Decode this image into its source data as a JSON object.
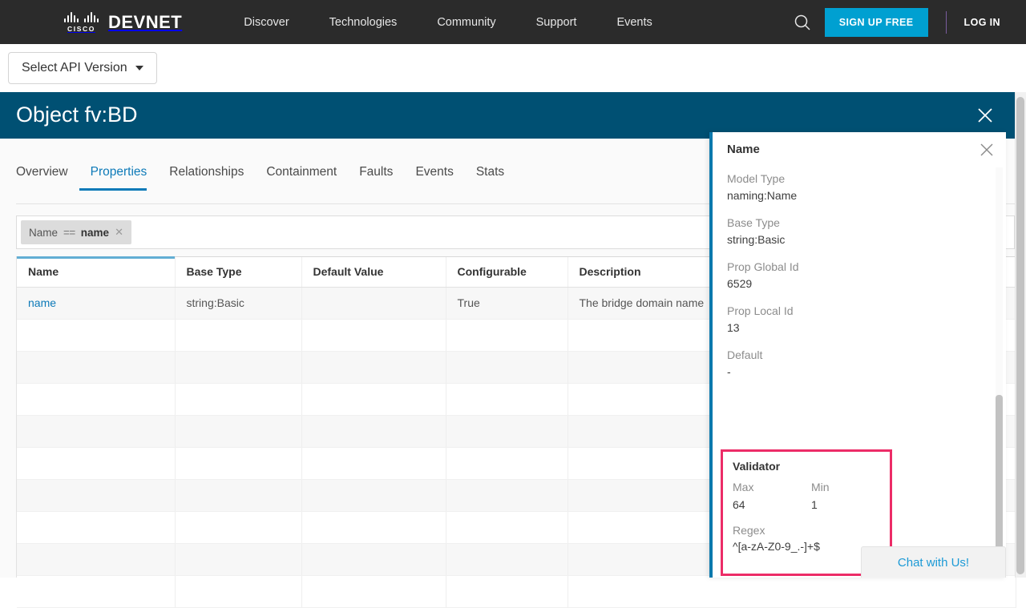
{
  "topnav": {
    "brand_cisco": "CISCO",
    "brand_devnet": "DEVNET",
    "links": [
      "Discover",
      "Technologies",
      "Community",
      "Support",
      "Events"
    ],
    "search_icon": "search-icon",
    "signup_label": "SIGN UP FREE",
    "login_label": "LOG IN",
    "bg_color": "#2b2b2b",
    "accent_color": "#00a0d1"
  },
  "apibar": {
    "select_api_version_label": "Select API Version"
  },
  "object_header": {
    "title": "Object fv:BD",
    "close_icon": "close-icon",
    "bg_color": "#005073"
  },
  "tabs": [
    {
      "label": "Overview",
      "active": false
    },
    {
      "label": "Properties",
      "active": true
    },
    {
      "label": "Relationships",
      "active": false
    },
    {
      "label": "Containment",
      "active": false
    },
    {
      "label": "Faults",
      "active": false
    },
    {
      "label": "Events",
      "active": false
    },
    {
      "label": "Stats",
      "active": false
    }
  ],
  "filter": {
    "chip_field": "Name",
    "chip_operator": "==",
    "chip_value": "name",
    "chip_remove_icon": "close-icon"
  },
  "table": {
    "columns": [
      "Name",
      "Base Type",
      "Default Value",
      "Configurable",
      "Description"
    ],
    "rows": [
      {
        "name": "name",
        "base_type": "string:Basic",
        "default_value": "",
        "configurable": "True",
        "description": "The bridge domain name"
      }
    ],
    "empty_row_count": 9,
    "accent_color": "#62aed4"
  },
  "panel": {
    "title": "Name",
    "close_icon": "close-icon",
    "accent_color": "#0b79ad",
    "fields": [
      {
        "label": "Model Type",
        "value": "naming:Name"
      },
      {
        "label": "Base Type",
        "value": "string:Basic"
      },
      {
        "label": "Prop Global Id",
        "value": "6529"
      },
      {
        "label": "Prop Local Id",
        "value": "13"
      },
      {
        "label": "Default",
        "value": "-"
      }
    ],
    "validator": {
      "title": "Validator",
      "max_label": "Max",
      "max_value": "64",
      "min_label": "Min",
      "min_value": "1",
      "regex_label": "Regex",
      "regex_value": "^[a-zA-Z0-9_.-]+$",
      "highlight_color": "#ec2c67"
    }
  },
  "chat": {
    "label": "Chat with Us!",
    "color": "#1c9ad6"
  }
}
